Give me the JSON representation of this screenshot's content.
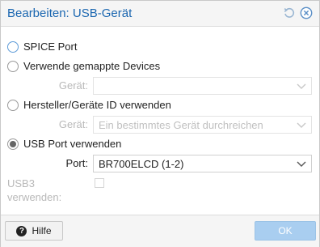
{
  "dialog": {
    "title": "Bearbeiten: USB-Gerät",
    "reset_icon": "reset-icon",
    "close_icon": "close-circle-icon"
  },
  "options": {
    "spice": {
      "label": "SPICE Port",
      "checked": false
    },
    "mapped": {
      "label": "Verwende gemappte Devices",
      "checked": false,
      "device_label": "Gerät:",
      "device_value": ""
    },
    "vendor": {
      "label": "Hersteller/Geräte ID verwenden",
      "checked": false,
      "device_label": "Gerät:",
      "device_placeholder": "Ein bestimmtes Gerät durchreichen"
    },
    "port": {
      "label": "USB Port verwenden",
      "checked": true,
      "port_label": "Port:",
      "port_value": "BR700ELCD (1-2)"
    }
  },
  "usb3": {
    "label_line1": "USB3",
    "label_line2": "verwenden:",
    "checked": false
  },
  "footer": {
    "help_label": "Hilfe",
    "ok_label": "OK"
  },
  "colors": {
    "title": "#1a66b0",
    "ok_bg": "#a9cef0",
    "header_bg": "#f5f5f5"
  }
}
